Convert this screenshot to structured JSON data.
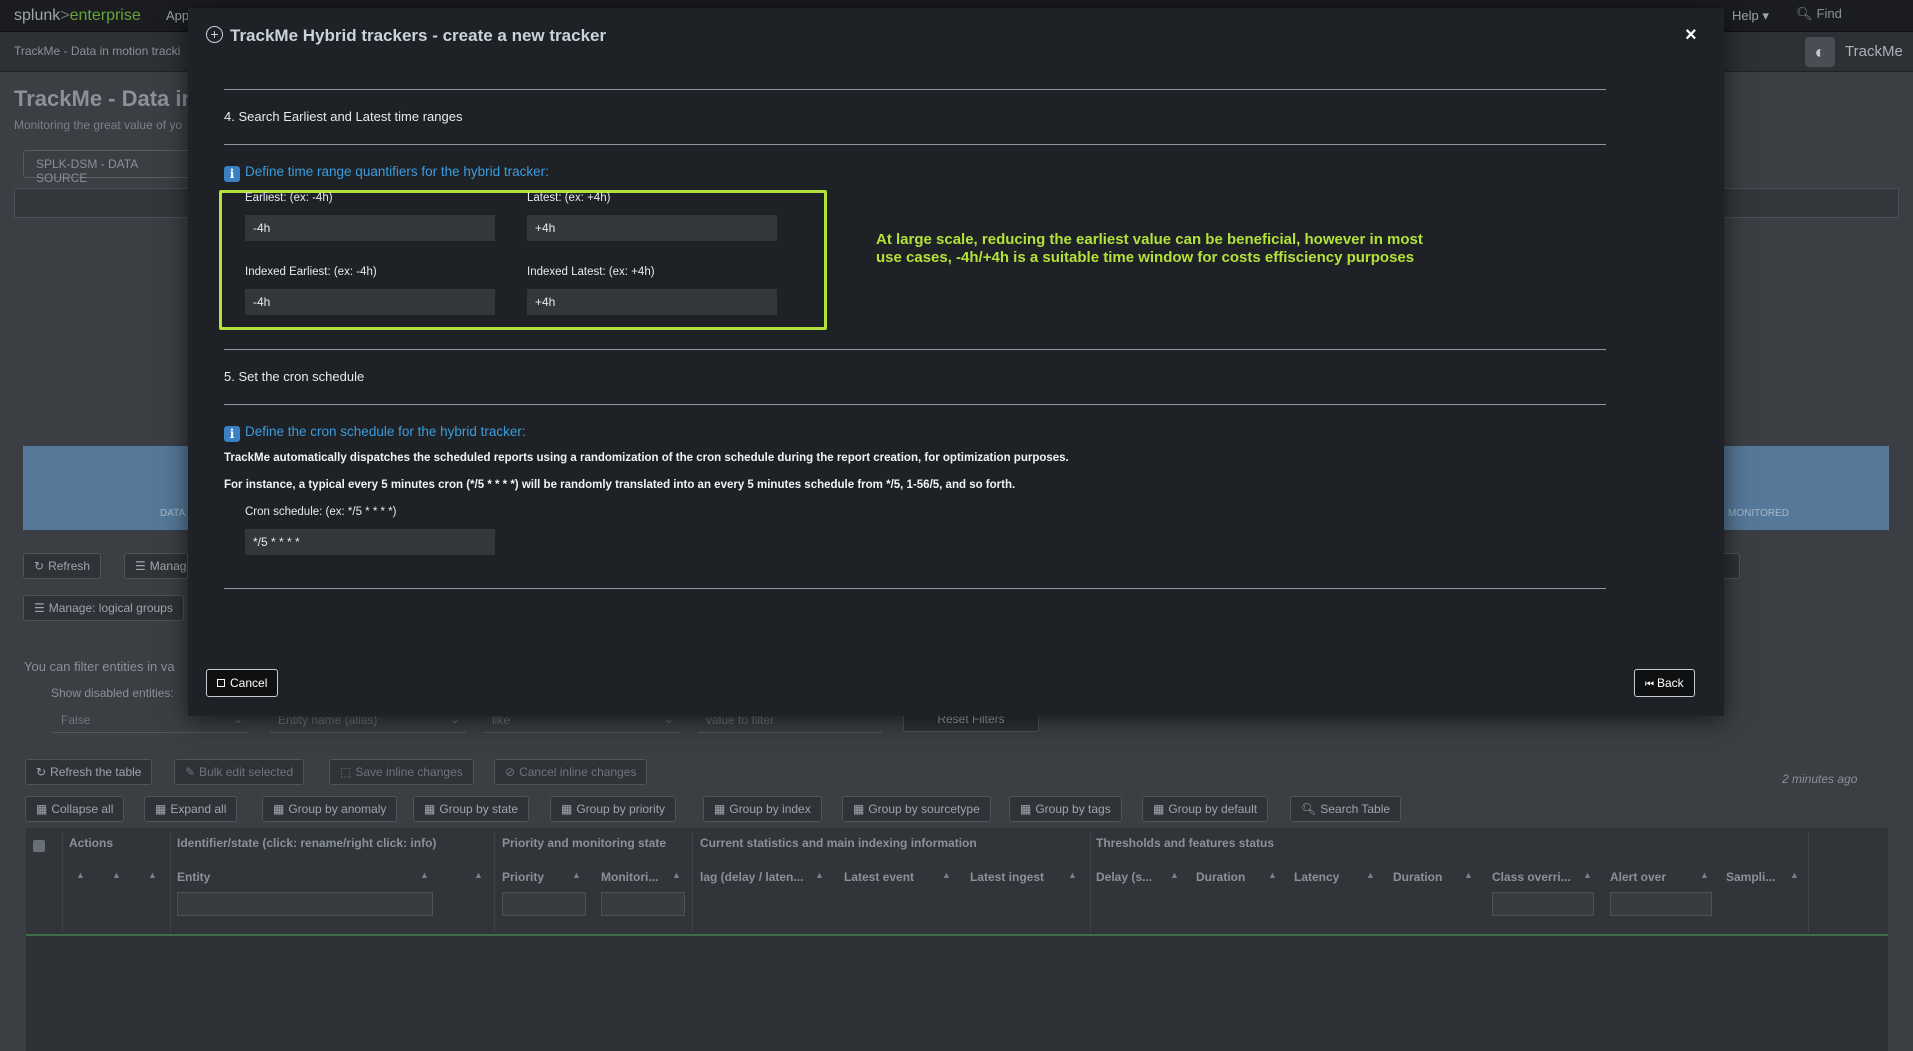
{
  "background": {
    "brand": {
      "splunk": "splunk",
      "sep": ">",
      "enterprise": "enterprise"
    },
    "top_apps": "App",
    "help": "Help ▾",
    "find_placeholder": "Find",
    "crumb": "TrackMe - Data in motion tracki",
    "app_logo_label": "TrackMe",
    "page_title": "TrackMe - Data in",
    "page_subtitle": "Monitoring the great value of yo",
    "tab_label": "SPLK-DSM - DATA SOURCE",
    "kpi_left_label": "DATA",
    "kpi_right_label": "MONITORED",
    "buttons": {
      "refresh": "Refresh",
      "manage": "Manag",
      "manage_logical_groups": "Manage: logical groups"
    },
    "filter_hint": "You can filter entities in va",
    "show_disabled_label": "Show disabled entities:",
    "filter_selects": {
      "disabled_value": "False",
      "field_value": "Entity name (alias)",
      "operator_value": "like",
      "value_placeholder": "value to filter"
    },
    "reset_filters": "Reset Filters",
    "table_actions": {
      "refresh_table": "Refresh the table",
      "bulk_edit": "Bulk edit selected",
      "save_inline": "Save inline changes",
      "cancel_inline": "Cancel inline changes"
    },
    "updated": "2 minutes ago",
    "group_buttons": {
      "collapse_all": "Collapse all",
      "expand_all": "Expand all",
      "group_by_anomaly": "Group by anomaly",
      "group_by_state": "Group by state",
      "group_by_priority": "Group by priority",
      "group_by_index": "Group by index",
      "group_by_sourcetype": "Group by sourcetype",
      "group_by_tags": "Group by tags",
      "group_by_default": "Group by default",
      "search_table": "Search Table"
    },
    "table_groups": {
      "actions": "Actions",
      "identifier": "Identifier/state (click: rename/right click: info)",
      "priority": "Priority and monitoring state",
      "current_stats": "Current statistics and main indexing information",
      "thresholds": "Thresholds and features status"
    },
    "table_columns": {
      "entity": "Entity",
      "priority": "Priority",
      "monitoring": "Monitori...",
      "lag": "lag (delay / laten...",
      "latest_event": "Latest event",
      "latest_ingest": "Latest ingest",
      "delay": "Delay (s...",
      "duration1": "Duration",
      "latency": "Latency",
      "duration2": "Duration",
      "class_override": "Class overri...",
      "alert_over": "Alert over",
      "sampling": "Sampli..."
    }
  },
  "modal": {
    "title": "TrackMe Hybrid trackers - create a new tracker",
    "close_label": "×",
    "section4_title": "4. Search Earliest and Latest time ranges",
    "time_info": "Define time range quantifiers for the hybrid tracker:",
    "earliest_label": "Earliest: (ex: -4h)",
    "earliest_value": "-4h",
    "latest_label": "Latest: (ex: +4h)",
    "latest_value": "+4h",
    "indexed_earliest_label": "Indexed Earliest: (ex: -4h)",
    "indexed_earliest_value": "-4h",
    "indexed_latest_label": "Indexed Latest: (ex: +4h)",
    "indexed_latest_value": "+4h",
    "note_line1": "At large scale, reducing the earliest value can be beneficial, however in most",
    "note_line2": "use cases, -4h/+4h is a suitable time window for costs effisciency purposes",
    "section5_title": "5. Set the cron schedule",
    "cron_info": "Define the cron schedule for the hybrid tracker:",
    "cron_para1": "TrackMe automatically dispatches the scheduled reports using a randomization of the cron schedule during the report creation, for optimization purposes.",
    "cron_para2": "For instance, a typical every 5 minutes cron (*/5 * * * *) will be randomly translated into an every 5 minutes schedule from */5, 1-56/5, and so forth.",
    "cron_label": "Cron schedule: (ex: */5 * * * *)",
    "cron_value": "*/5 * * * *",
    "cancel_label": "Cancel",
    "back_label": "Back"
  },
  "colors": {
    "accent_highlight": "#b5e23a",
    "info_blue": "#3b9ddd",
    "modal_bg": "#1e2125",
    "kpi_band": "#567999"
  }
}
